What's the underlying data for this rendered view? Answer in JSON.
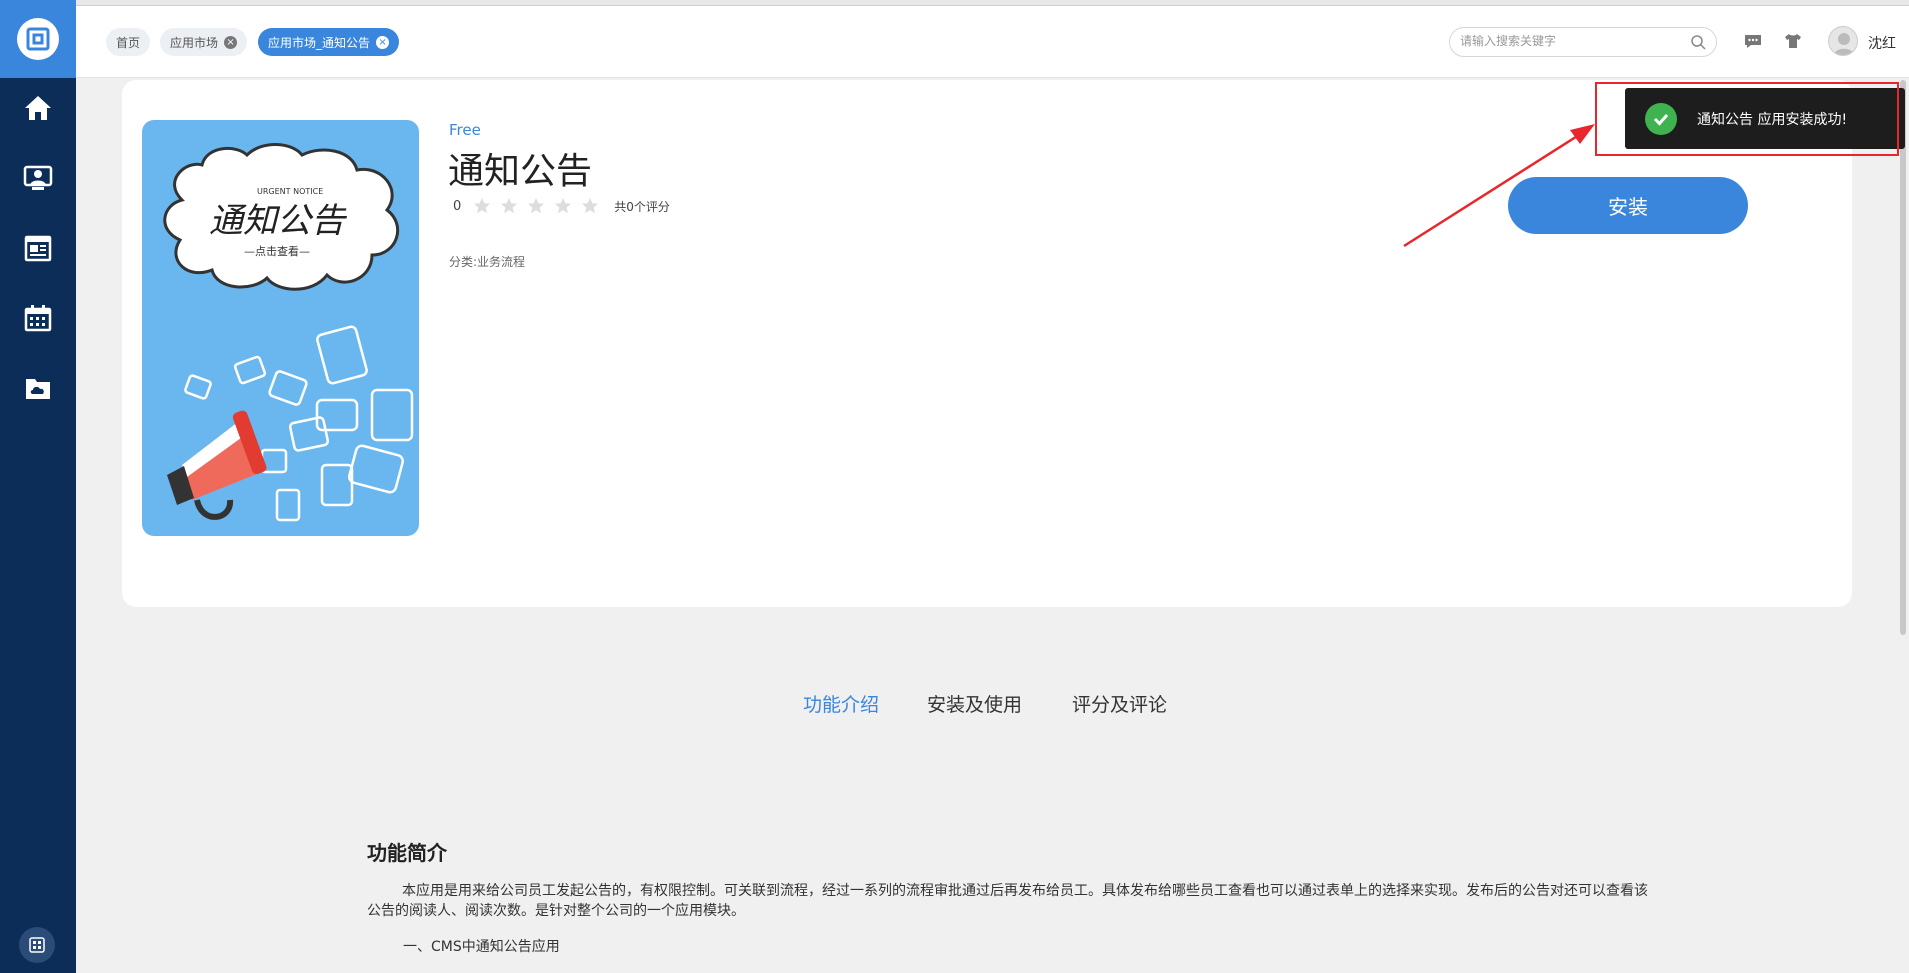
{
  "topbar": {
    "tabs": [
      {
        "label": "首页",
        "active": false,
        "closable": false
      },
      {
        "label": "应用市场",
        "active": false,
        "closable": true
      },
      {
        "label": "应用市场_通知公告",
        "active": true,
        "closable": true
      }
    ],
    "search_placeholder": "请输入搜索关键字",
    "username": "沈红"
  },
  "sidebar": {
    "items": [
      {
        "icon": "home-icon"
      },
      {
        "icon": "user-profile-icon"
      },
      {
        "icon": "news-icon"
      },
      {
        "icon": "calendar-icon"
      },
      {
        "icon": "cloud-folder-icon"
      }
    ]
  },
  "app": {
    "price": "Free",
    "title": "通知公告",
    "score": "0",
    "stars_filled": 0,
    "stars_total": 5,
    "rating_count": "共0个评分",
    "category": "分类:业务流程",
    "install_label": "安装",
    "image_texts": {
      "small": "URGENT NOTICE",
      "main": "通知公告",
      "sub": "—点击查看—"
    }
  },
  "toast": {
    "message": "通知公告 应用安装成功!"
  },
  "content_tabs": [
    {
      "label": "功能介绍",
      "active": true
    },
    {
      "label": "安装及使用",
      "active": false
    },
    {
      "label": "评分及评论",
      "active": false
    }
  ],
  "description": {
    "title": "功能简介",
    "text": "本应用是用来给公司员工发起公告的，有权限控制。可关联到流程，经过一系列的流程审批通过后再发布给员工。具体发布给哪些员工查看也可以通过表单上的选择来实现。发布后的公告对还可以查看该公告的阅读人、阅读次数。是针对整个公司的一个应用模块。",
    "section_1": "一、CMS中通知公告应用"
  },
  "colors": {
    "accent": "#3a86dc",
    "sidebar": "#0c2d57",
    "toast_bg": "#1d1d1d",
    "success": "#3fb34f",
    "highlight": "#e8262c"
  }
}
